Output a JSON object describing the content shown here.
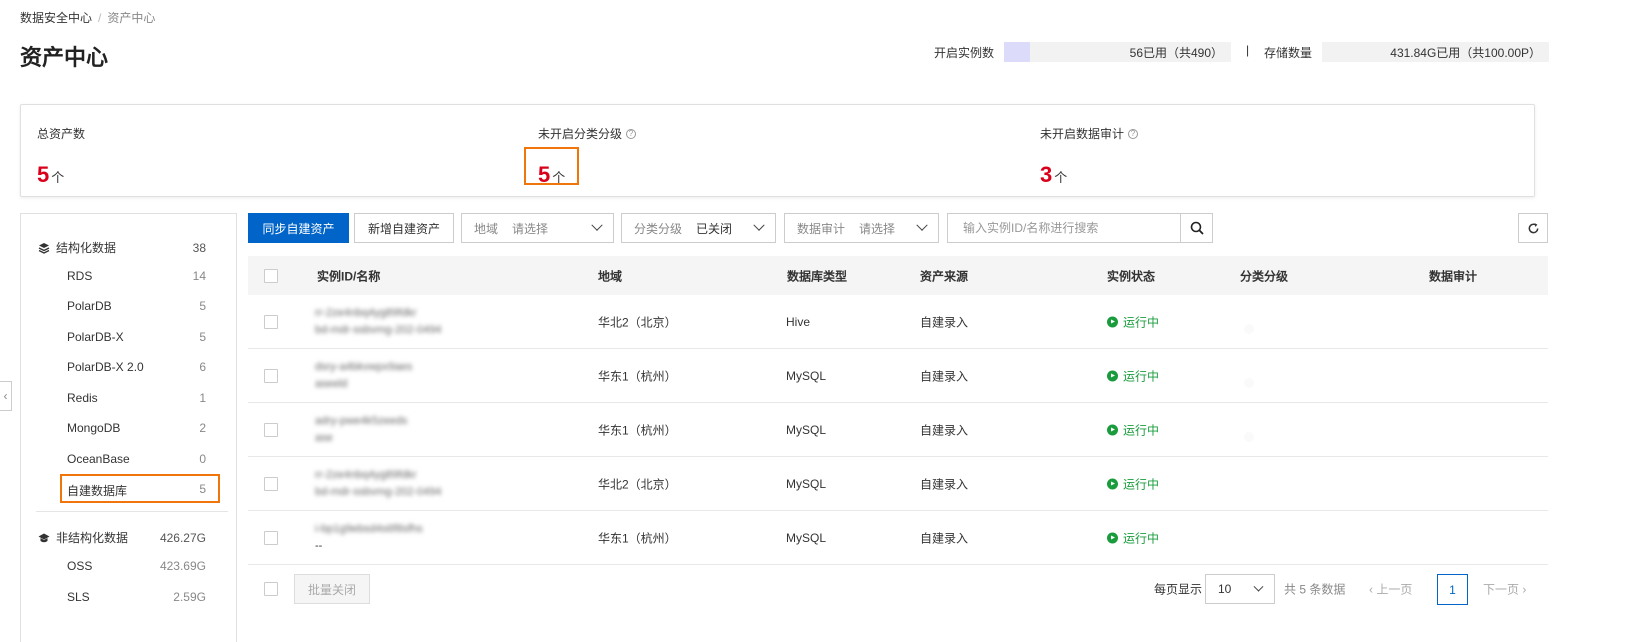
{
  "breadcrumb": {
    "root": "数据安全中心",
    "separator": "/",
    "current": "资产中心"
  },
  "page_title": "资产中心",
  "quota": {
    "instances": {
      "label": "开启实例数",
      "text": "56已用（共490）",
      "used_fraction": 0.114
    },
    "divider": "|",
    "storage": {
      "label": "存储数量",
      "text": "431.84G已用（共100.00P）",
      "used_fraction": 0.0
    }
  },
  "stats": [
    {
      "label": "总资产数",
      "value": "5",
      "unit": "个",
      "help": false
    },
    {
      "label": "未开启分类分级",
      "value": "5",
      "unit": "个",
      "help": true
    },
    {
      "label": "未开启数据审计",
      "value": "3",
      "unit": "个",
      "help": true
    }
  ],
  "sidebar": {
    "structured": {
      "label": "结构化数据",
      "count": "38",
      "items": [
        {
          "label": "RDS",
          "count": "14"
        },
        {
          "label": "PolarDB",
          "count": "5"
        },
        {
          "label": "PolarDB-X",
          "count": "5"
        },
        {
          "label": "PolarDB-X 2.0",
          "count": "6"
        },
        {
          "label": "Redis",
          "count": "1"
        },
        {
          "label": "MongoDB",
          "count": "2"
        },
        {
          "label": "OceanBase",
          "count": "0"
        },
        {
          "label": "自建数据库",
          "count": "5"
        }
      ]
    },
    "unstructured": {
      "label": "非结构化数据",
      "count": "426.27G",
      "items": [
        {
          "label": "OSS",
          "count": "423.69G"
        },
        {
          "label": "SLS",
          "count": "2.59G"
        }
      ]
    },
    "collapse_glyph": "‹"
  },
  "toolbar": {
    "sync_button": "同步自建资产",
    "add_button": "新增自建资产",
    "region_select": {
      "label": "地域",
      "value": "请选择"
    },
    "classify_select": {
      "label": "分类分级",
      "value": "已关闭"
    },
    "audit_select": {
      "label": "数据审计",
      "value": "请选择"
    },
    "search_placeholder": "输入实例ID/名称进行搜索"
  },
  "table": {
    "columns": [
      "实例ID/名称",
      "地域",
      "数据库类型",
      "资产来源",
      "实例状态",
      "分类分级",
      "数据审计"
    ],
    "rows": [
      {
        "id_line1": "rr-2ze4nbq4yg89fdkr",
        "id_line2": "bd-mdr-ssbvmg-202-0494",
        "region": "华北2（北京）",
        "db_type": "Hive",
        "source": "自建录入",
        "status": "运行中",
        "classify": "disabled",
        "audit": "off"
      },
      {
        "id_line1": "dsry-a4bkvwpx9aes",
        "id_line2": "aseeld",
        "region": "华东1（杭州）",
        "db_type": "MySQL",
        "source": "自建录入",
        "status": "运行中",
        "classify": "disabled",
        "audit": "off"
      },
      {
        "id_line1": "adry-pwe4k5zeeds",
        "id_line2": "ase",
        "region": "华东1（杭州）",
        "db_type": "MySQL",
        "source": "自建录入",
        "status": "运行中",
        "classify": "disabled",
        "audit": "off"
      },
      {
        "id_line1": "rr-2ze4nbq4yg89fdkr",
        "id_line2": "bd-mdr-ssbvmg-202-0494",
        "region": "华北2（北京）",
        "db_type": "MySQL",
        "source": "自建录入",
        "status": "运行中",
        "classify": "off",
        "audit": "off"
      },
      {
        "id_line1": "i-bp1g9ebsd4s6f8sfhs",
        "id_line2": "--",
        "region": "华东1（杭州）",
        "db_type": "MySQL",
        "source": "自建录入",
        "status": "运行中",
        "classify": "off",
        "audit": "off"
      }
    ]
  },
  "footer": {
    "batch_close": "批量关闭",
    "per_page_label": "每页显示",
    "page_size": "10",
    "total_text": "共 5 条数据",
    "prev": "‹ 上一页",
    "current_page": "1",
    "next": "下一页 ›"
  },
  "colors": {
    "primary": "#0064c8",
    "highlight": "#f0750a",
    "stat_number": "#d9001b",
    "running": "#1a9c3d"
  }
}
